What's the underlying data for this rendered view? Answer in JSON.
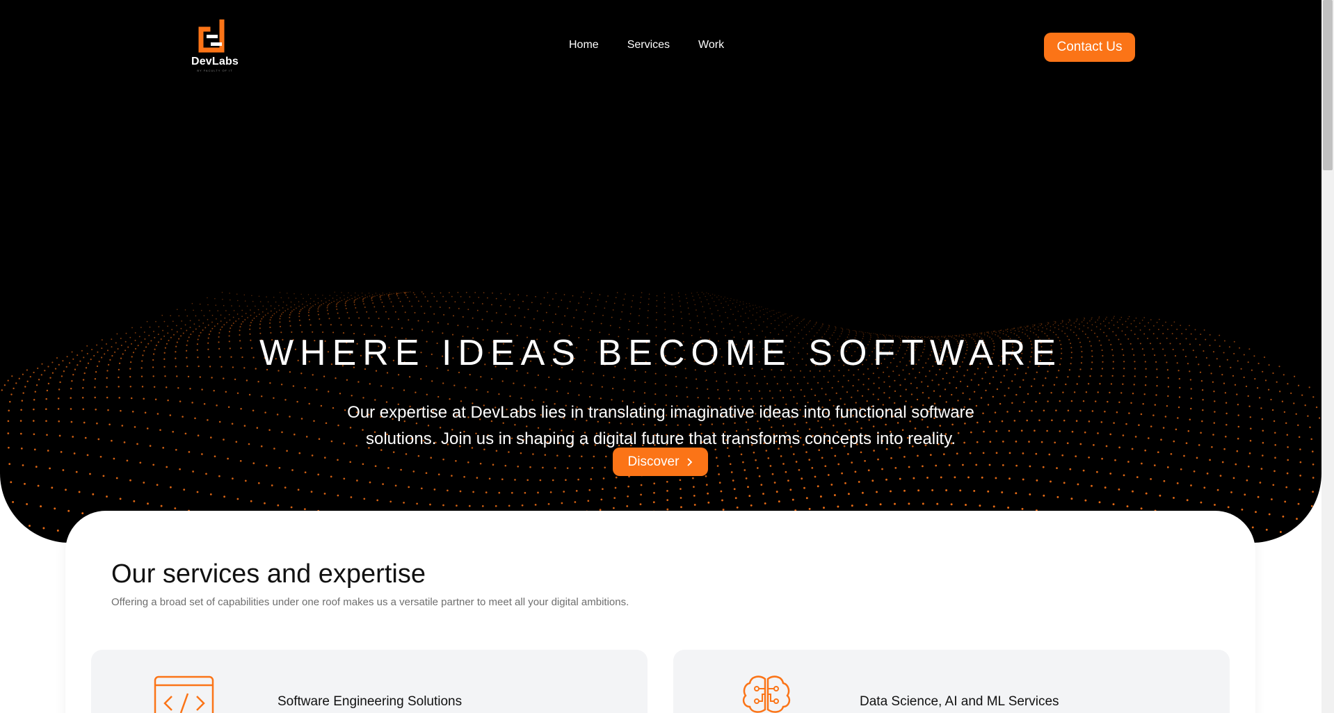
{
  "brand": {
    "name": "DevLabs",
    "tagline": "BY FACULTY OF IT",
    "accent": "#fb7417"
  },
  "nav": {
    "items": [
      {
        "label": "Home"
      },
      {
        "label": "Services"
      },
      {
        "label": "Work"
      }
    ],
    "contact_label": "Contact Us"
  },
  "hero": {
    "title": "WHERE IDEAS BECOME SOFTWARE",
    "subtitle": "Our expertise at DevLabs lies in translating imaginative ideas into functional software solutions. Join us in shaping a digital future that transforms concepts into reality.",
    "cta_label": "Discover",
    "cta_icon": "chevron-right-icon"
  },
  "services": {
    "title": "Our services and expertise",
    "subtitle": "Offering a broad set of capabilities under one roof makes us a versatile partner to meet all your digital ambitions.",
    "cards": [
      {
        "label": "Software Engineering Solutions",
        "icon": "code-window-icon"
      },
      {
        "label": "Data Science, AI and ML Services",
        "icon": "brain-circuit-icon"
      }
    ]
  }
}
